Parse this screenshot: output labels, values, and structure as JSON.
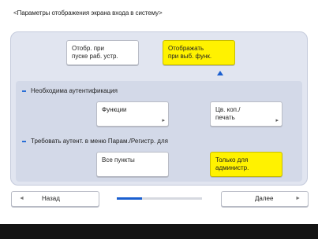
{
  "title": "<Параметры отображения экрана входа в систему>",
  "display_timing": {
    "options": [
      {
        "label_line1": "Отобр. при",
        "label_line2": "пуске раб. устр.",
        "selected": false
      },
      {
        "label_line1": "Отображать",
        "label_line2": "при выб. функ.",
        "selected": true
      }
    ]
  },
  "auth_required": {
    "label": "Необходима аутентификация",
    "buttons": [
      {
        "label_line1": "Функции",
        "label_line2": ""
      },
      {
        "label_line1": "Цв. коп./",
        "label_line2": "печать"
      }
    ]
  },
  "settings_auth": {
    "label": "Требовать аутент. в меню Парам./Регистр. для",
    "options": [
      {
        "label_line1": "Все пункты",
        "label_line2": "",
        "selected": false
      },
      {
        "label_line1": "Только для",
        "label_line2": "администр.",
        "selected": true
      }
    ]
  },
  "nav": {
    "back_label": "Назад",
    "next_label": "Далее",
    "progress": 0.3
  },
  "colors": {
    "selected": "#fff200",
    "accent": "#1a5fd0"
  }
}
